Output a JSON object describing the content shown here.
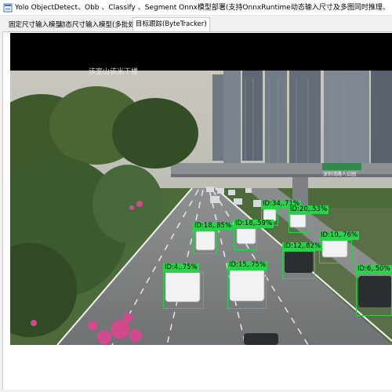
{
  "window": {
    "title": "Yolo ObjectDetect、Obb 、Classify 、Segment Onnx模型部署(支持OnnxRuntime动态输入尺寸及多图同时推理、OpenVINO、TensorRT加速) (最低版",
    "icon": "app-icon"
  },
  "tabs": [
    {
      "label": "固定尺寸输入模型",
      "active": false
    },
    {
      "label": "动态尺寸输入模型(多批处理)",
      "active": false
    },
    {
      "label": "目标跟踪(ByteTracker)",
      "active": true
    }
  ],
  "viewer": {
    "overlay_caption": "该室山该米下楼",
    "building_sign": "深圳湾路人公园",
    "box_color": "#2bd14a"
  },
  "detections": [
    {
      "label": "ID:34,.71%"
    },
    {
      "label": "ID:20,.53%"
    },
    {
      "label": "ID:18,.85%"
    },
    {
      "label": "ID:18,.59%"
    },
    {
      "label": "ID:10,.76%"
    },
    {
      "label": "ID:12,.82%"
    },
    {
      "label": "ID:4,.75%"
    },
    {
      "label": "ID:15,.75%"
    },
    {
      "label": "ID:6,.50%"
    }
  ]
}
